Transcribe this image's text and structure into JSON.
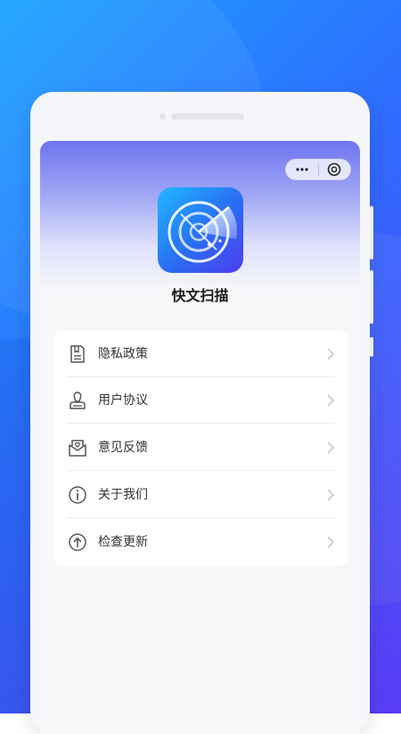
{
  "app": {
    "name": "快文扫描"
  },
  "capsule": {
    "more_icon": "more-dots-icon",
    "close_icon": "close-circle-icon"
  },
  "menu": {
    "items": [
      {
        "label": "隐私政策",
        "icon": "document-icon"
      },
      {
        "label": "用户协议",
        "icon": "user-stamp-icon"
      },
      {
        "label": "意见反馈",
        "icon": "mail-heart-icon"
      },
      {
        "label": "关于我们",
        "icon": "info-icon"
      },
      {
        "label": "检查更新",
        "icon": "upload-arrow-icon"
      }
    ]
  },
  "colors": {
    "background_start": "#1aa3ff",
    "background_end": "#5a3cf5",
    "header_top": "#6e74ef",
    "icon_stroke": "#555555",
    "chevron": "#c8c8c8"
  }
}
